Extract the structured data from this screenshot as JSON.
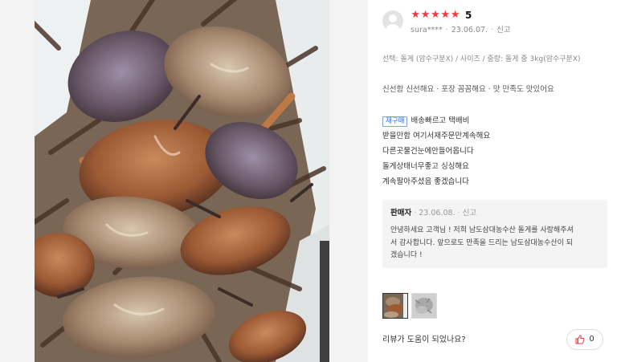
{
  "review": {
    "rating": 5,
    "score_label": "5",
    "stars": [
      "★",
      "★",
      "★",
      "★",
      "★"
    ],
    "username": "sura****",
    "date": "23.06.07.",
    "report_label": "신고",
    "option": "선택: 돌게 (암수구분X) / 사이즈 / 중량: 돌게 중 3kg(암수구분X)",
    "evaluation": "신선함 신선해요 · 포장 꼼꼼해요 · 맛 만족도 맛있어요",
    "repurchase_badge": "재구매",
    "lines": [
      "배송빠르고 택배비",
      "받을만함 여기서재주문만계속해요",
      "다른곳물건눈에안들어옵니다",
      "돌게상태너무좋고 싱싱해요",
      "계속팔아주셨음 좋겠습니다"
    ]
  },
  "reply": {
    "name": "판매자",
    "date": "23.06.08.",
    "report_label": "신고",
    "lines": [
      "안녕하세요 고객님 ! 저희 남도삼대농수산 돌게를 사랑해주셔",
      "서 감사합니다. 앞으로도 만족을 드리는 남도삼대농수산이 되",
      "겠습니다 !"
    ]
  },
  "footer": {
    "helpful_question": "리뷰가 도움이 되었나요?",
    "like_count": "0"
  },
  "colors": {
    "star": "#f0363f",
    "badge": "#3b6fc4",
    "reply_bg": "#f4f4f4"
  },
  "icons": {
    "like": "thumbs-up-icon",
    "avatar": "user-avatar-icon"
  }
}
